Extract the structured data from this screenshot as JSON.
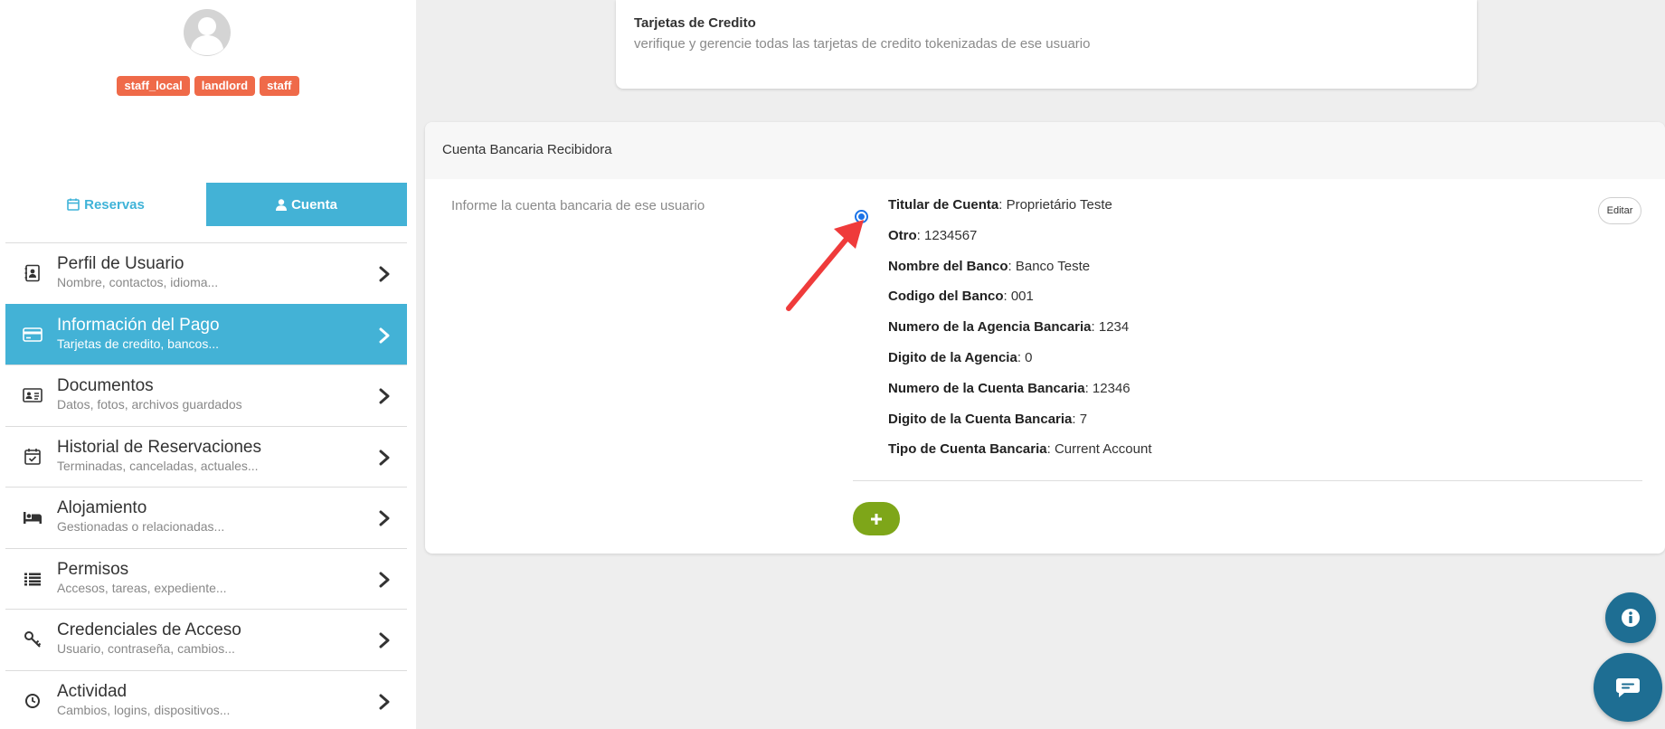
{
  "profile": {
    "badges": [
      "staff_local",
      "landlord",
      "staff"
    ]
  },
  "tabs": {
    "reservas": "Reservas",
    "cuenta": "Cuenta"
  },
  "menu": {
    "items": [
      {
        "title": "Perfil de Usuario",
        "sub": "Nombre, contactos, idioma..."
      },
      {
        "title": "Información del Pago",
        "sub": "Tarjetas de credito, bancos..."
      },
      {
        "title": "Documentos",
        "sub": "Datos, fotos, archivos guardados"
      },
      {
        "title": "Historial de Reservaciones",
        "sub": "Terminadas, canceladas, actuales..."
      },
      {
        "title": "Alojamiento",
        "sub": "Gestionadas o relacionadas..."
      },
      {
        "title": "Permisos",
        "sub": "Accesos, tareas, expediente..."
      },
      {
        "title": "Credenciales de Acceso",
        "sub": "Usuario, contraseña, cambios..."
      },
      {
        "title": "Actividad",
        "sub": "Cambios, logins, dispositivos..."
      }
    ]
  },
  "cards": {
    "top": {
      "title": "Tarjetas de Credito",
      "sub": "verifique y gerencie todas las tarjetas de credito tokenizadas de ese usuario"
    },
    "bank": {
      "title": "Cuenta Bancaria Recibidora",
      "hint": "Informe la cuenta bancaria de ese usuario",
      "edit_label": "Editar",
      "add_label": "+",
      "fields": [
        {
          "label": "Titular de Cuenta",
          "value": ": Proprietário Teste"
        },
        {
          "label": "Otro",
          "value": ": 1234567"
        },
        {
          "label": "Nombre del Banco",
          "value": ": Banco Teste"
        },
        {
          "label": "Codigo del Banco",
          "value": ": 001"
        },
        {
          "label": "Numero de la Agencia Bancaria",
          "value": ": 1234"
        },
        {
          "label": "Digito de la Agencia",
          "value": ": 0"
        },
        {
          "label": "Numero de la Cuenta Bancaria",
          "value": ": 12346"
        },
        {
          "label": "Digito de la Cuenta Bancaria",
          "value": ": 7"
        },
        {
          "label": "Tipo de Cuenta Bancaria",
          "value": ": Current Account"
        }
      ]
    }
  },
  "colors": {
    "accent": "#43b2d6",
    "badge": "#ef6a49",
    "add_button": "#7ea619",
    "fab": "#1e6e93",
    "annotation_arrow": "#ef3b3b"
  },
  "icons": {
    "avatar": "user-avatar-icon",
    "info": "info-icon",
    "chat": "chat-icon"
  }
}
